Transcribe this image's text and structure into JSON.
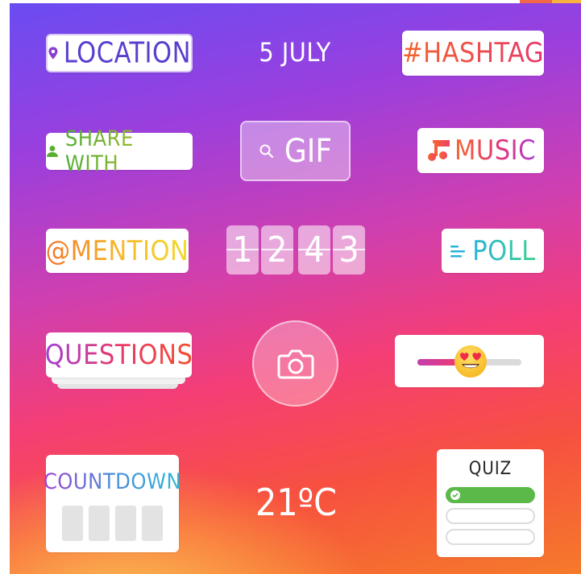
{
  "stickers": {
    "location": {
      "label": "LOCATION",
      "icon": "location-pin-icon"
    },
    "date": {
      "label": "5 JULY"
    },
    "hashtag": {
      "label": "#HASHTAG"
    },
    "share_with": {
      "label": "SHARE WITH",
      "icon": "person-icon"
    },
    "gif": {
      "label": "GIF",
      "icon": "search-icon"
    },
    "music": {
      "label": "MUSIC",
      "icon": "music-note-icon"
    },
    "mention": {
      "label": "@MENTION"
    },
    "time_digits": [
      "1",
      "2",
      "4",
      "3"
    ],
    "poll": {
      "label": "POLL",
      "icon": "poll-lines-icon"
    },
    "questions": {
      "label": "QUESTIONS"
    },
    "camera": {
      "icon": "camera-icon"
    },
    "emoji_slider": {
      "icon": "heart-eyes-emoji-icon",
      "level": 0.4
    },
    "countdown": {
      "label": "COUNTDOWN",
      "boxes": 4
    },
    "temperature": {
      "label": "21ºC"
    },
    "quiz": {
      "label": "QUIZ",
      "options": 3,
      "correct_index": 0
    }
  },
  "colors": {
    "gradient_top": "#6a4cf2",
    "gradient_mid": "#f43e76",
    "gradient_bottom": "#f7b33e",
    "location_text": "#5a3fcf",
    "quiz_correct": "#5bb94a"
  }
}
